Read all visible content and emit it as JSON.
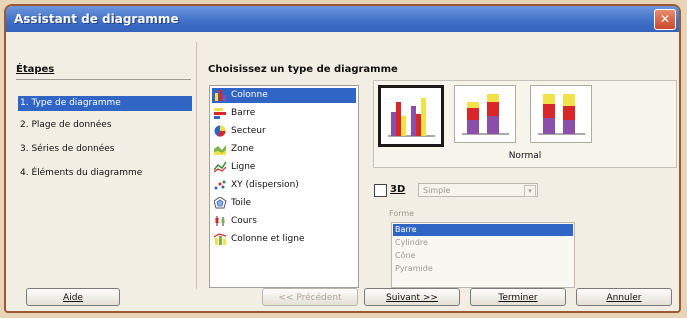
{
  "window": {
    "title": "Assistant de diagramme",
    "close_symbol": "✕"
  },
  "steps": {
    "title": "Étapes",
    "items": [
      {
        "label": "1. Type de diagramme",
        "active": true
      },
      {
        "label": "2. Plage de données",
        "active": false
      },
      {
        "label": "3. Séries de données",
        "active": false
      },
      {
        "label": "4. Éléments du diagramme",
        "active": false
      }
    ]
  },
  "chart_type": {
    "heading": "Choisissez un type de diagramme",
    "types": [
      {
        "label": "Colonne",
        "icon": "column-chart-icon",
        "active": true
      },
      {
        "label": "Barre",
        "icon": "bar-chart-icon",
        "active": false
      },
      {
        "label": "Secteur",
        "icon": "pie-chart-icon",
        "active": false
      },
      {
        "label": "Zone",
        "icon": "area-chart-icon",
        "active": false
      },
      {
        "label": "Ligne",
        "icon": "line-chart-icon",
        "active": false
      },
      {
        "label": "XY (dispersion)",
        "icon": "scatter-chart-icon",
        "active": false
      },
      {
        "label": "Toile",
        "icon": "net-chart-icon",
        "active": false
      },
      {
        "label": "Cours",
        "icon": "stock-chart-icon",
        "active": false
      },
      {
        "label": "Colonne et ligne",
        "icon": "column-line-chart-icon",
        "active": false
      }
    ],
    "variants": [
      {
        "name": "normal-column-variant",
        "selected": true
      },
      {
        "name": "stacked-column-variant",
        "selected": false
      },
      {
        "name": "percent-stacked-column-variant",
        "selected": false
      }
    ],
    "variant_label": "Normal"
  },
  "options": {
    "three_d_label": "3D",
    "three_d_checked": false,
    "mode_value": "Simple",
    "shape_label": "Forme",
    "shapes": [
      {
        "label": "Barre",
        "active": true
      },
      {
        "label": "Cylindre",
        "active": false
      },
      {
        "label": "Cône",
        "active": false
      },
      {
        "label": "Pyramide",
        "active": false
      }
    ]
  },
  "buttons": {
    "help": "Aide",
    "previous": "<< Précédent",
    "next": "Suivant >>",
    "finish": "Terminer",
    "cancel": "Annuler"
  },
  "colors": {
    "titlebar": "#3f6fc7",
    "selection": "#3165c5",
    "bar_purple": "#8a4fa8",
    "bar_red": "#d8262a",
    "bar_yellow": "#f1e24a"
  }
}
